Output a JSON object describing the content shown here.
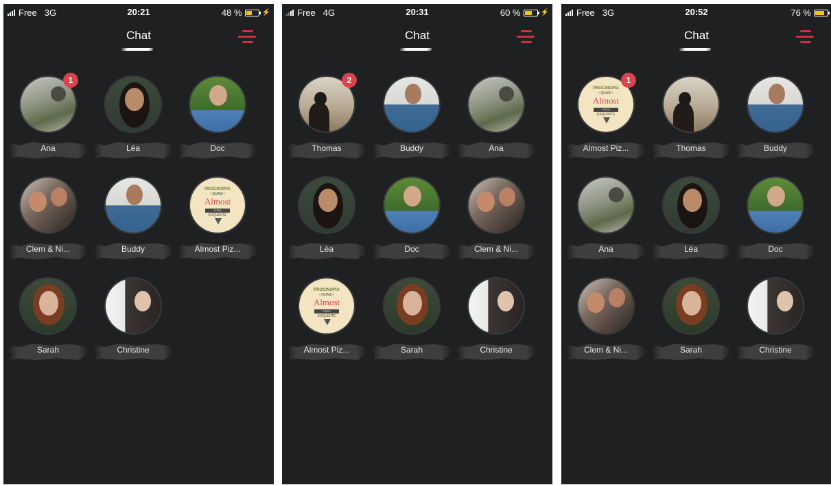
{
  "screens": [
    {
      "status": {
        "carrier": "Free",
        "network": "3G",
        "time": "20:21",
        "battery": "48 %",
        "battery_level": 0.48,
        "charging": true
      },
      "title": "Chat",
      "contacts": [
        {
          "name": "Ana",
          "avatar": "ana-photo",
          "badge": "1"
        },
        {
          "name": "Léa",
          "avatar": "lea-photo",
          "badge": null
        },
        {
          "name": "Doc",
          "avatar": "doc-photo",
          "badge": null
        },
        {
          "name": "Clem & Ni...",
          "avatar": "clem-photo",
          "badge": null
        },
        {
          "name": "Buddy",
          "avatar": "buddy-photo",
          "badge": null
        },
        {
          "name": "Almost Piz...",
          "avatar": "pizza-logo",
          "badge": null
        },
        {
          "name": "Sarah",
          "avatar": "sarah-photo",
          "badge": null
        },
        {
          "name": "Christine",
          "avatar": "christine-photo",
          "badge": null
        }
      ]
    },
    {
      "status": {
        "carrier": "Free",
        "network": "4G",
        "time": "20:31",
        "battery": "60 %",
        "battery_level": 0.6,
        "charging": true
      },
      "title": "Chat",
      "contacts": [
        {
          "name": "Thomas",
          "avatar": "thomas-photo",
          "badge": "2"
        },
        {
          "name": "Buddy",
          "avatar": "buddy-photo",
          "badge": null
        },
        {
          "name": "Ana",
          "avatar": "ana-photo",
          "badge": null
        },
        {
          "name": "Léa",
          "avatar": "lea-photo",
          "badge": null
        },
        {
          "name": "Doc",
          "avatar": "doc-photo",
          "badge": null
        },
        {
          "name": "Clem & Ni...",
          "avatar": "clem-photo",
          "badge": null
        },
        {
          "name": "Almost Piz...",
          "avatar": "pizza-logo",
          "badge": null
        },
        {
          "name": "Sarah",
          "avatar": "sarah-photo",
          "badge": null
        },
        {
          "name": "Christine",
          "avatar": "christine-photo",
          "badge": null
        }
      ]
    },
    {
      "status": {
        "carrier": "Free",
        "network": "3G",
        "time": "20:52",
        "battery": "76 %",
        "battery_level": 0.76,
        "charging": false
      },
      "title": "Chat",
      "contacts": [
        {
          "name": "Almost Piz...",
          "avatar": "pizza-logo",
          "badge": "1"
        },
        {
          "name": "Thomas",
          "avatar": "thomas-photo",
          "badge": null
        },
        {
          "name": "Buddy",
          "avatar": "buddy-photo",
          "badge": null
        },
        {
          "name": "Ana",
          "avatar": "ana-photo",
          "badge": null
        },
        {
          "name": "Léa",
          "avatar": "lea-photo",
          "badge": null
        },
        {
          "name": "Doc",
          "avatar": "doc-photo",
          "badge": null
        },
        {
          "name": "Clem & Ni...",
          "avatar": "clem-photo",
          "badge": null
        },
        {
          "name": "Sarah",
          "avatar": "sarah-photo",
          "badge": null
        },
        {
          "name": "Christine",
          "avatar": "christine-photo",
          "badge": null
        }
      ]
    }
  ],
  "pizza_logo": {
    "top": "PROCINOPIA",
    "sub": "• QUASI •",
    "word": "Almost",
    "band": "PIZZA",
    "bottom": "EXQUISITE"
  },
  "colors": {
    "background": "#1f2022",
    "accent": "#d0303d",
    "badge": "#d9434d",
    "battery": "#f5c518",
    "name_plate": "#3d3e40"
  }
}
